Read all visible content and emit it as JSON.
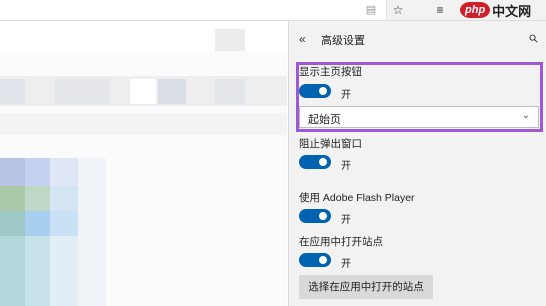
{
  "toolbar": {
    "reading_icon": "reading-view-icon",
    "favorite_icon": "star-icon",
    "hub_icon": "hub-icon",
    "watermark_logo": "php",
    "watermark_text": "中文网"
  },
  "panel": {
    "title": "高级设置",
    "back_icon": "double-chevron-left-icon",
    "pin_icon": "pin-icon",
    "settings": [
      {
        "label": "显示主页按钮",
        "toggle_on": true,
        "state": "开"
      },
      {
        "label": "阻止弹出窗口",
        "toggle_on": true,
        "state": "开"
      },
      {
        "label": "使用 Adobe Flash Player",
        "toggle_on": true,
        "state": "开"
      },
      {
        "label": "在应用中打开站点",
        "toggle_on": true,
        "state": "开"
      }
    ],
    "home_dropdown": {
      "selected": "起始页"
    },
    "open_sites_button": "选择在应用中打开的站点"
  },
  "colors": {
    "accent": "#0063b1",
    "highlight": "#9b59d8",
    "panel_bg": "#f2f2f2"
  }
}
